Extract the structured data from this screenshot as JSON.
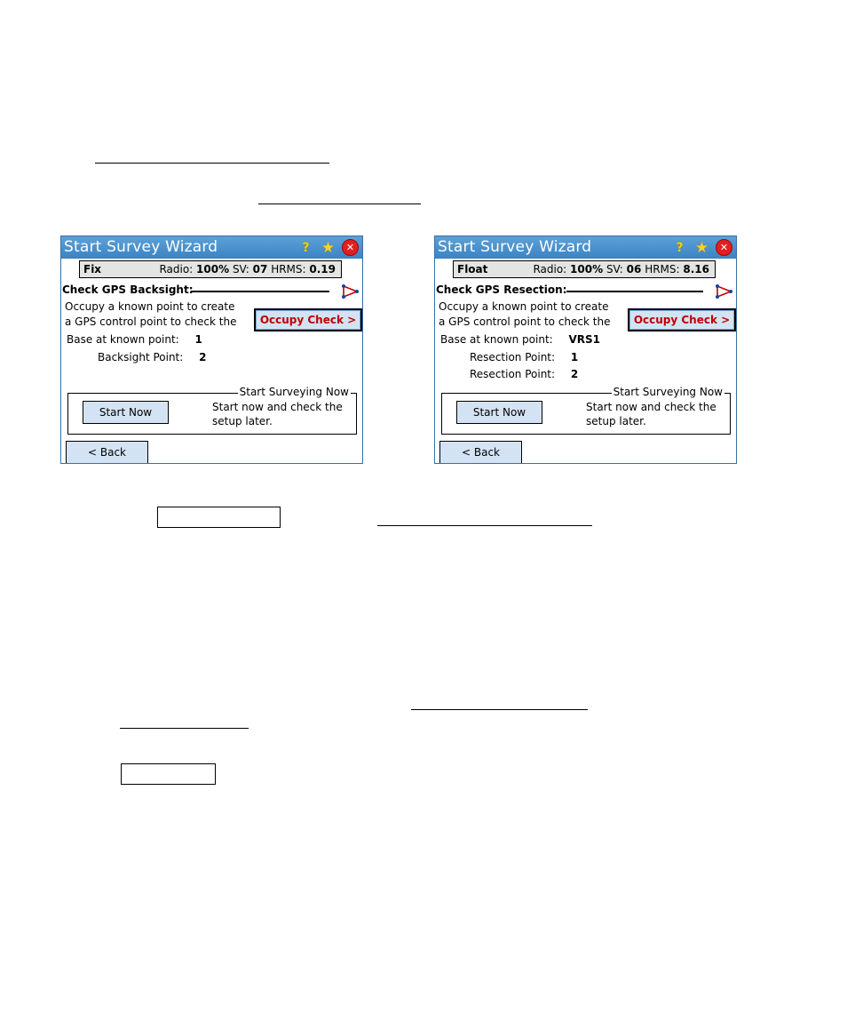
{
  "windows": [
    {
      "title": "Start Survey Wizard",
      "status": {
        "fix": "Fix",
        "radio_label": "Radio:",
        "radio": "100%",
        "sv_label": "SV:",
        "sv": "07",
        "hrms_label": "HRMS:",
        "hrms": "0.19"
      },
      "section": "Check GPS Backsight:",
      "text_line1": "Occupy a known point to create",
      "text_line2": "a GPS control point to check the",
      "occupy_button": "Occupy Check >",
      "rows": [
        {
          "label": "Base at known point:",
          "value": "1"
        },
        {
          "label": "Backsight Point:",
          "value": "2"
        }
      ],
      "group_title": "Start Surveying Now",
      "start_now_button": "Start Now",
      "group_text1": "Start now and check the",
      "group_text2": "setup later.",
      "back_button": "< Back"
    },
    {
      "title": "Start Survey Wizard",
      "status": {
        "fix": "Float",
        "radio_label": "Radio:",
        "radio": "100%",
        "sv_label": "SV:",
        "sv": "06",
        "hrms_label": "HRMS:",
        "hrms": "8.16"
      },
      "section": "Check GPS Resection:",
      "text_line1": "Occupy a known point to create",
      "text_line2": "a GPS control point to check the",
      "occupy_button": "Occupy Check >",
      "rows": [
        {
          "label": "Base at known point:",
          "value": "VRS1"
        },
        {
          "label": "Resection Point:",
          "value": "1"
        },
        {
          "label": "Resection Point:",
          "value": "2"
        }
      ],
      "group_title": "Start Surveying Now",
      "start_now_button": "Start Now",
      "group_text1": "Start now and check the",
      "group_text2": "setup later.",
      "back_button": "< Back"
    }
  ],
  "icons": {
    "help": "help-icon",
    "favorite": "star-icon",
    "close": "close-icon",
    "survey": "survey-icon"
  }
}
